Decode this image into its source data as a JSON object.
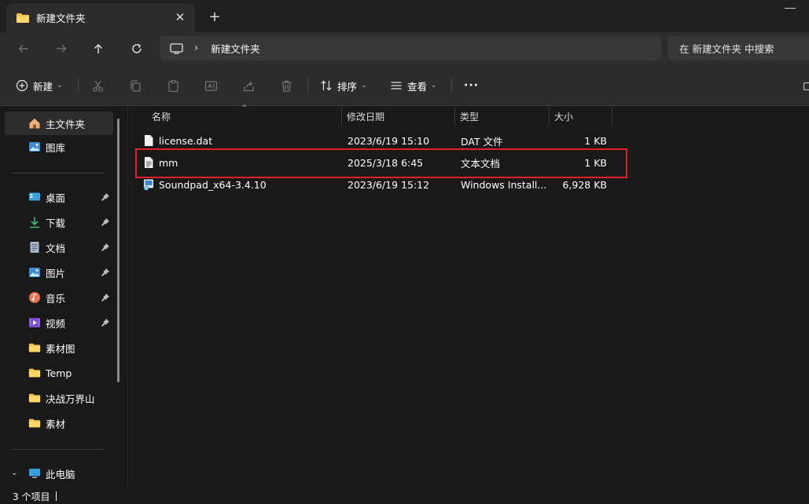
{
  "tab": {
    "title": "新建文件夹",
    "close": "✕",
    "new_tab": "+"
  },
  "address": {
    "crumb": "新建文件夹",
    "separator": "›",
    "search_placeholder": "在 新建文件夹 中搜索"
  },
  "commands": {
    "new_label": "新建",
    "sort_label": "排序",
    "view_label": "查看",
    "more": "···"
  },
  "sidebar": {
    "top": [
      {
        "label": "主文件夹",
        "icon": "home-icon"
      },
      {
        "label": "图库",
        "icon": "gallery-icon"
      }
    ],
    "quick": [
      {
        "label": "桌面",
        "icon": "desktop-icon",
        "pinned": true
      },
      {
        "label": "下载",
        "icon": "download-icon",
        "pinned": true
      },
      {
        "label": "文档",
        "icon": "document-icon",
        "pinned": true
      },
      {
        "label": "图片",
        "icon": "pictures-icon",
        "pinned": true
      },
      {
        "label": "音乐",
        "icon": "music-icon",
        "pinned": true
      },
      {
        "label": "视频",
        "icon": "video-icon",
        "pinned": true
      },
      {
        "label": "素材图",
        "icon": "folder-icon",
        "pinned": false
      },
      {
        "label": "Temp",
        "icon": "folder-icon",
        "pinned": false
      },
      {
        "label": "决战万界山",
        "icon": "folder-icon",
        "pinned": false
      },
      {
        "label": "素材",
        "icon": "folder-icon",
        "pinned": false
      }
    ],
    "this_pc": {
      "label": "此电脑",
      "icon": "computer-icon"
    }
  },
  "columns": {
    "name": "名称",
    "modified": "修改日期",
    "type": "类型",
    "size": "大小"
  },
  "files": [
    {
      "name": "license.dat",
      "modified": "2023/6/19 15:10",
      "type": "DAT 文件",
      "size": "1 KB",
      "icon": "file-icon"
    },
    {
      "name": "mm",
      "modified": "2025/3/18 6:45",
      "type": "文本文档",
      "size": "1 KB",
      "icon": "text-file-icon"
    },
    {
      "name": "Soundpad_x64-3.4.10",
      "modified": "2023/6/19 15:12",
      "type": "Windows Install...",
      "size": "6,928 KB",
      "icon": "installer-icon"
    }
  ],
  "status": {
    "item_count": "3 个项目"
  },
  "colors": {
    "background": "#191919",
    "chrome": "#2c2c2c",
    "highlight_box": "#e0202a",
    "folder": "#f4c34a"
  }
}
